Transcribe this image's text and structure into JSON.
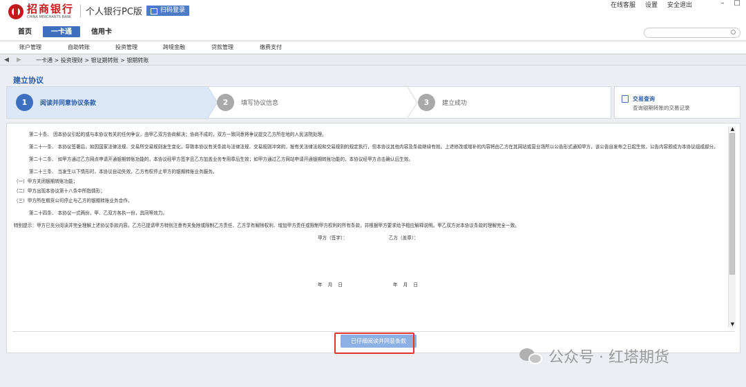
{
  "header": {
    "bank_name": "招商银行",
    "bank_name_en": "CHINA MERCHANTS BANK",
    "app_title": "个人银行PC版",
    "qr_login_label": "扫码登录",
    "links": [
      "在线客服",
      "设置",
      "安全退出"
    ],
    "window_controls": [
      "–",
      "□"
    ]
  },
  "main_nav": {
    "items": [
      {
        "label": "首页",
        "active": false
      },
      {
        "label": "一卡通",
        "active": true
      },
      {
        "label": "信用卡",
        "active": false
      }
    ]
  },
  "search": {
    "placeholder": ""
  },
  "sub_nav": {
    "items": [
      "账户管理",
      "自助转账",
      "投资管理",
      "跨境金融",
      "贷款管理",
      "缴费支付"
    ]
  },
  "breadcrumb": {
    "back": "◀",
    "forward": "▶",
    "path": "一卡通 > 投资理财 > 银证期转账 > 银期转账"
  },
  "page_title": "建立协议",
  "steps": [
    {
      "num": "1",
      "label": "阅读并同意协议条款",
      "active": true
    },
    {
      "num": "2",
      "label": "填写协议信息",
      "active": false
    },
    {
      "num": "3",
      "label": "建立成功",
      "active": false
    }
  ],
  "query": {
    "title": "交易查询",
    "desc": "查询银期转账的交易记录"
  },
  "agreement": {
    "paragraphs": [
      "第二十条、   因本协议引起的或与本协议有关的任何争议，由甲乙双方协商解决；协商不成的，双方一致同意将争议提交乙方所在地的人民法院处理。",
      "第二十一条、   本协议签署后，如因国家法律法规、交易所交易规则发生变化，导致本协议有关条款与法律法规、交易规则冲突的，按有关法律法规和交易规则的规定执行，但本协议其他内容及条款继续有效。上述修改或增补的内容将由乙方在其网站或营业场所以公告形式通知甲方，该公告自发布之日起生效，公告内容即成为本协议组成部分。",
      "第二十二条、   如甲方通过乙方网点申请开通银期转账功能的，本协议经甲方签字且乙方加盖业务专用章后生效；如甲方通过乙方网站申请开通银期转账功能的，本协议经甲方点击确认后生效。",
      "第二十三条、   当发生以下情形时，本协议自动失效，乙方有权停止甲方的银期转账业务服务。"
    ],
    "list_items": [
      "（一）甲方关闭银期转账功能；",
      "（二）甲方出现本协议第十八条中所指情形；",
      "（三）甲方所在期货公司停止与乙方的银期转账业务合作。"
    ],
    "paragraphs_2": [
      "第二十四条、   本协议一式两份，甲、乙双方各执一份，具同等效力。",
      "特别提示：甲方已充分阅读并完全理解上述协议条款内容。乙方已提请甲方特别注意有关免除或限制乙方责任、乙方享有解除权利、增加甲方责任或限制甲方权利的所有条款，并根据甲方要求给予相应解释说明。甲乙双方对本协议条款的理解完全一致。"
    ],
    "party_a_sign": "甲方（签字）：",
    "party_b_seal": "乙方（盖章）：",
    "date_a": "年  月  日",
    "date_b": "年  月  日"
  },
  "agree_button": "已仔细阅读并同意条款",
  "watermark": "公众号 · 红塔期货",
  "colors": {
    "brand_red": "#c8161d",
    "accent_blue": "#3f70c0",
    "highlight_red": "#e0342c",
    "button_blue": "#8db0e4"
  }
}
